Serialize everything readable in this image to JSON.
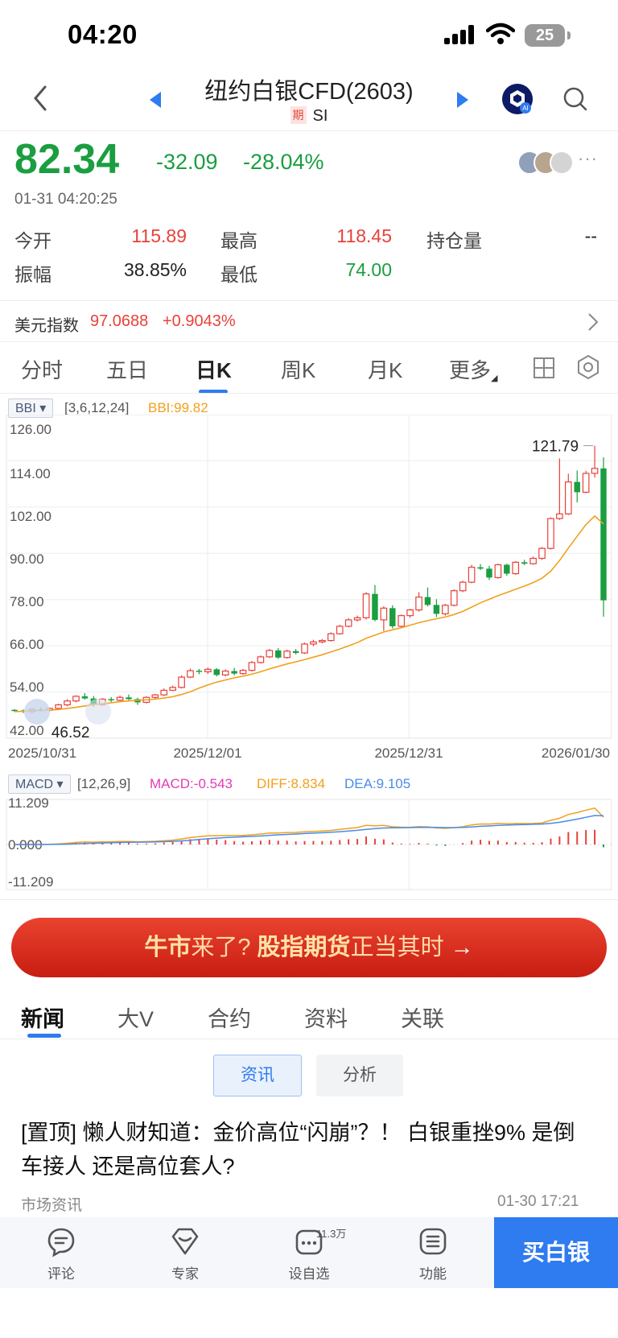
{
  "status": {
    "time": "04:20",
    "battery": "25"
  },
  "header": {
    "title": "纽约白银CFD(2603)",
    "tag": "期",
    "code": "SI"
  },
  "quote": {
    "price": "82.34",
    "change": "-32.09",
    "change_pct": "-28.04%",
    "time": "01-31 04:20:25",
    "open_label": "今开",
    "open": "115.89",
    "high_label": "最高",
    "high": "118.45",
    "oi_label": "持仓量",
    "oi": "--",
    "amp_label": "振幅",
    "amp": "38.85%",
    "low_label": "最低",
    "low": "74.00"
  },
  "dxy": {
    "label": "美元指数",
    "value": "97.0688",
    "change": "+0.9043%"
  },
  "period_tabs": [
    "分时",
    "五日",
    "日K",
    "周K",
    "月K",
    "更多"
  ],
  "indicator": {
    "name": "BBI",
    "params": "[3,6,12,24]",
    "value": "BBI:99.82"
  },
  "macd": {
    "name": "MACD",
    "params": "[12,26,9]",
    "macd": "MACD:-0.543",
    "diff": "DIFF:8.834",
    "dea": "DEA:9.105",
    "ticks": [
      "11.209",
      "0.000",
      "-11.209"
    ]
  },
  "chart_data": {
    "type": "candlestick",
    "y_ticks": [
      "126.00",
      "114.00",
      "102.00",
      "90.00",
      "78.00",
      "66.00",
      "54.00",
      "42.00"
    ],
    "ylim": [
      42,
      126
    ],
    "x_labels": [
      "2025/10/31",
      "2025/12/01",
      "2025/12/31",
      "2026/01/30"
    ],
    "max_label": "121.79",
    "min_label": "46.52",
    "colors": {
      "up": "#e8413a",
      "down": "#1a9e40",
      "bbi": "#f2a01c",
      "diff": "#f2a01c",
      "dea": "#4a8be8"
    },
    "candles": [
      [
        47.5,
        47.7,
        47.0,
        47.3
      ],
      [
        47.3,
        47.6,
        46.6,
        47.0
      ],
      [
        47.0,
        48.0,
        46.5,
        47.6
      ],
      [
        47.6,
        48.2,
        47.0,
        47.4
      ],
      [
        47.4,
        48.1,
        47.0,
        47.9
      ],
      [
        47.9,
        49.2,
        47.6,
        48.9
      ],
      [
        48.9,
        50.5,
        48.5,
        50.0
      ],
      [
        50.0,
        51.6,
        49.6,
        51.3
      ],
      [
        51.3,
        52.2,
        50.4,
        50.7
      ],
      [
        50.7,
        51.4,
        48.4,
        49.0
      ],
      [
        49.0,
        50.8,
        48.6,
        50.5
      ],
      [
        50.5,
        51.1,
        49.7,
        50.2
      ],
      [
        50.2,
        51.5,
        49.8,
        51.0
      ],
      [
        51.0,
        51.8,
        50.2,
        50.5
      ],
      [
        50.5,
        50.9,
        48.9,
        49.6
      ],
      [
        49.6,
        51.3,
        49.3,
        51.0
      ],
      [
        51.0,
        52.0,
        50.5,
        51.7
      ],
      [
        51.7,
        53.5,
        51.4,
        53.0
      ],
      [
        53.0,
        54.3,
        52.8,
        53.8
      ],
      [
        53.8,
        57.2,
        53.5,
        56.7
      ],
      [
        56.7,
        59.1,
        56.4,
        58.5
      ],
      [
        58.5,
        59.0,
        57.5,
        58.2
      ],
      [
        58.2,
        59.4,
        57.6,
        58.9
      ],
      [
        58.9,
        59.2,
        56.9,
        57.3
      ],
      [
        57.3,
        58.9,
        56.9,
        58.4
      ],
      [
        58.4,
        59.3,
        57.2,
        57.7
      ],
      [
        57.7,
        59.0,
        57.4,
        58.6
      ],
      [
        58.6,
        61.2,
        58.3,
        60.8
      ],
      [
        60.8,
        62.8,
        60.5,
        62.4
      ],
      [
        62.4,
        64.6,
        62.1,
        64.2
      ],
      [
        64.2,
        64.9,
        61.8,
        62.2
      ],
      [
        62.2,
        64.4,
        61.9,
        64.0
      ],
      [
        64.0,
        64.6,
        63.1,
        63.5
      ],
      [
        63.5,
        66.4,
        63.2,
        66.0
      ],
      [
        66.0,
        67.2,
        65.4,
        66.6
      ],
      [
        66.6,
        67.4,
        66.2,
        67.0
      ],
      [
        67.0,
        69.3,
        66.7,
        68.9
      ],
      [
        68.9,
        71.4,
        68.6,
        71.0
      ],
      [
        71.0,
        73.3,
        70.7,
        72.8
      ],
      [
        72.8,
        74.0,
        72.3,
        73.4
      ],
      [
        73.4,
        80.6,
        72.9,
        80.1
      ],
      [
        80.1,
        82.6,
        72.4,
        72.8
      ],
      [
        72.8,
        76.6,
        69.7,
        76.1
      ],
      [
        76.1,
        76.9,
        70.4,
        71.0
      ],
      [
        71.0,
        74.3,
        70.6,
        74.0
      ],
      [
        74.0,
        75.9,
        73.4,
        75.6
      ],
      [
        75.6,
        80.6,
        75.1,
        79.2
      ],
      [
        79.2,
        81.9,
        76.6,
        77.0
      ],
      [
        77.0,
        78.6,
        73.6,
        74.5
      ],
      [
        74.5,
        77.3,
        74.0,
        76.9
      ],
      [
        76.9,
        81.4,
        76.6,
        81.0
      ],
      [
        81.0,
        83.8,
        80.6,
        83.4
      ],
      [
        83.4,
        88.3,
        83.1,
        87.6
      ],
      [
        87.6,
        88.5,
        86.8,
        87.2
      ],
      [
        87.2,
        88.0,
        84.0,
        84.7
      ],
      [
        84.7,
        88.6,
        84.4,
        88.3
      ],
      [
        88.3,
        88.6,
        85.2,
        85.8
      ],
      [
        85.8,
        89.3,
        85.5,
        89.0
      ],
      [
        89.0,
        89.7,
        88.2,
        88.6
      ],
      [
        88.6,
        90.6,
        88.3,
        90.1
      ],
      [
        90.1,
        93.3,
        89.7,
        92.9
      ],
      [
        92.9,
        101.6,
        92.6,
        101.3
      ],
      [
        101.3,
        118.2,
        100.9,
        102.6
      ],
      [
        102.6,
        113.9,
        102.3,
        111.6
      ],
      [
        111.6,
        114.8,
        105.8,
        108.7
      ],
      [
        108.7,
        114.7,
        108.4,
        114.0
      ],
      [
        114.0,
        121.79,
        112.8,
        115.4
      ],
      [
        115.4,
        118.5,
        73.7,
        78.3
      ]
    ],
    "bbi": [
      47.0,
      47.1,
      47.2,
      47.3,
      47.4,
      47.6,
      47.9,
      48.2,
      48.6,
      49.0,
      49.2,
      49.5,
      49.8,
      50.0,
      50.2,
      50.3,
      50.5,
      50.8,
      51.2,
      51.8,
      52.6,
      53.6,
      54.5,
      55.3,
      55.9,
      56.5,
      57.0,
      57.5,
      58.2,
      59.0,
      59.7,
      60.4,
      61.0,
      61.6,
      62.3,
      63.0,
      63.8,
      64.6,
      65.5,
      66.4,
      67.6,
      68.5,
      69.4,
      70.0,
      70.6,
      71.3,
      72.0,
      72.6,
      73.1,
      73.6,
      74.3,
      75.2,
      76.4,
      77.6,
      78.6,
      79.6,
      80.5,
      81.4,
      82.3,
      83.3,
      84.5,
      86.5,
      89.5,
      93.0,
      96.3,
      99.6,
      102.0,
      99.8
    ]
  },
  "banner": {
    "p1": "牛市",
    "p2": "来了? ",
    "p3": "股指期货",
    "p4": "正当其时",
    "arrow": "→"
  },
  "news_tabs": [
    "新闻",
    "大V",
    "合约",
    "资料",
    "关联"
  ],
  "segments": [
    "资讯",
    "分析"
  ],
  "headline": {
    "text": "[置顶] 懒人财知道：金价高位“闪崩”？！ 白银重挫9% 是倒车接人 还是高位套人?",
    "source": "市场资讯",
    "time": "01-30 17:21"
  },
  "bottom_nav": {
    "comment": "评论",
    "expert": "专家",
    "watch": "设自选",
    "watch_badge": "11.3万",
    "func": "功能",
    "buy": "买白银"
  }
}
